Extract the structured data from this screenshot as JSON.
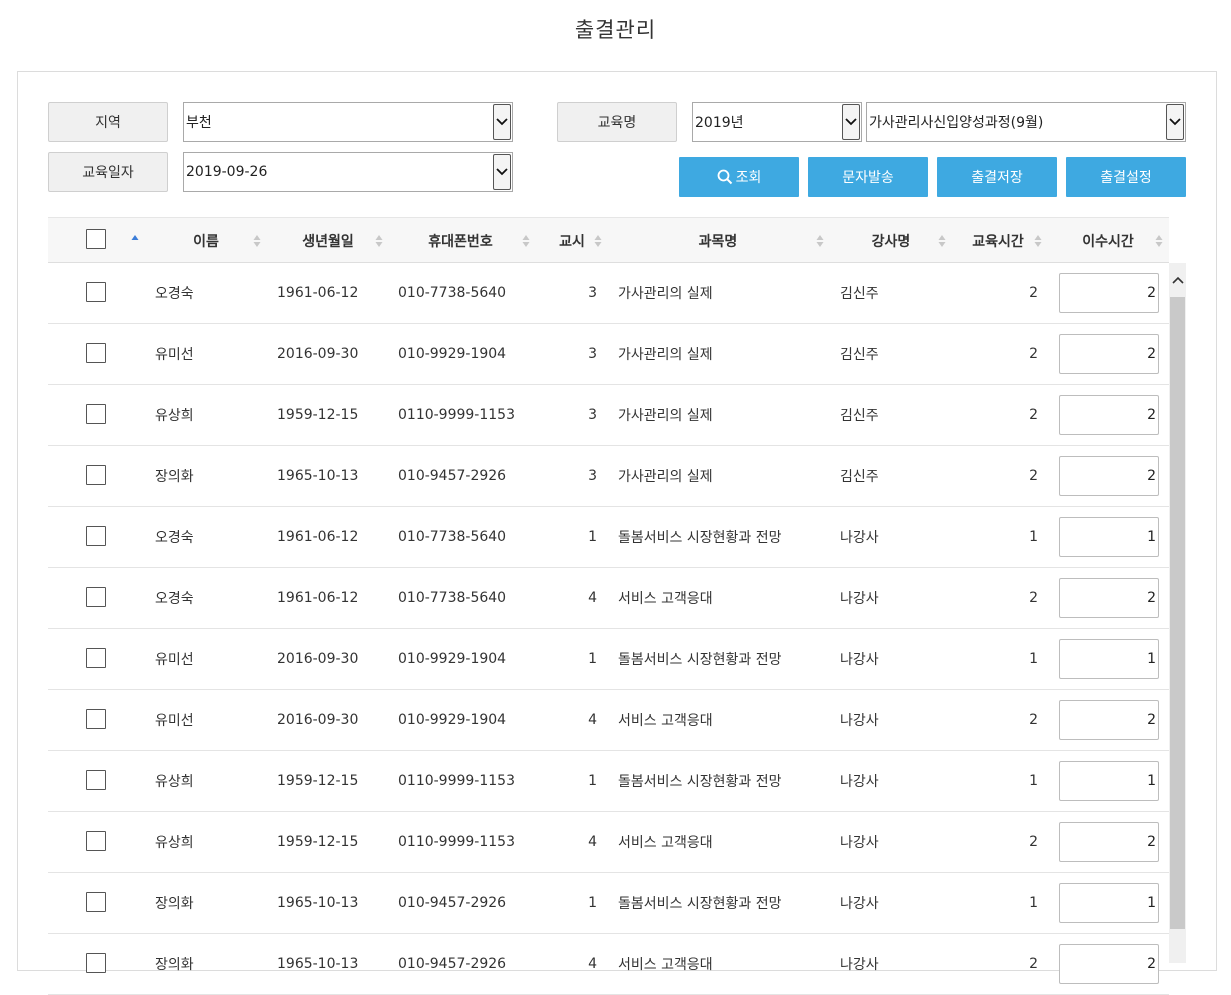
{
  "page": {
    "title": "출결관리"
  },
  "filters": {
    "region_label": "지역",
    "region_value": "부천",
    "course_label": "교육명",
    "year_value": "2019년",
    "course_value": "가사관리사신입양성과정(9월)",
    "date_label": "교육일자",
    "date_value": "2019-09-26"
  },
  "buttons": {
    "search": "조회",
    "sms": "문자발송",
    "save": "출결저장",
    "settings": "출결설정"
  },
  "colors": {
    "accent": "#3ea9e1",
    "sort_active": "#3b7dd8",
    "sort_inactive": "#c8c8c8"
  },
  "table": {
    "headers": [
      "이름",
      "생년월일",
      "휴대폰번호",
      "교시",
      "과목명",
      "강사명",
      "교육시간",
      "이수시간"
    ],
    "rows": [
      {
        "name": "오경숙",
        "birth": "1961-06-12",
        "phone": "010-7738-5640",
        "period": "3",
        "subject": "가사관리의 실제",
        "instructor": "김신주",
        "edu_hours": "2",
        "done_hours": "2"
      },
      {
        "name": "유미선",
        "birth": "2016-09-30",
        "phone": "010-9929-1904",
        "period": "3",
        "subject": "가사관리의 실제",
        "instructor": "김신주",
        "edu_hours": "2",
        "done_hours": "2"
      },
      {
        "name": "유상희",
        "birth": "1959-12-15",
        "phone": "0110-9999-1153",
        "period": "3",
        "subject": "가사관리의 실제",
        "instructor": "김신주",
        "edu_hours": "2",
        "done_hours": "2"
      },
      {
        "name": "장의화",
        "birth": "1965-10-13",
        "phone": "010-9457-2926",
        "period": "3",
        "subject": "가사관리의 실제",
        "instructor": "김신주",
        "edu_hours": "2",
        "done_hours": "2"
      },
      {
        "name": "오경숙",
        "birth": "1961-06-12",
        "phone": "010-7738-5640",
        "period": "1",
        "subject": "돌봄서비스 시장현황과 전망",
        "instructor": "나강사",
        "edu_hours": "1",
        "done_hours": "1"
      },
      {
        "name": "오경숙",
        "birth": "1961-06-12",
        "phone": "010-7738-5640",
        "period": "4",
        "subject": "서비스 고객응대",
        "instructor": "나강사",
        "edu_hours": "2",
        "done_hours": "2"
      },
      {
        "name": "유미선",
        "birth": "2016-09-30",
        "phone": "010-9929-1904",
        "period": "1",
        "subject": "돌봄서비스 시장현황과 전망",
        "instructor": "나강사",
        "edu_hours": "1",
        "done_hours": "1"
      },
      {
        "name": "유미선",
        "birth": "2016-09-30",
        "phone": "010-9929-1904",
        "period": "4",
        "subject": "서비스 고객응대",
        "instructor": "나강사",
        "edu_hours": "2",
        "done_hours": "2"
      },
      {
        "name": "유상희",
        "birth": "1959-12-15",
        "phone": "0110-9999-1153",
        "period": "1",
        "subject": "돌봄서비스 시장현황과 전망",
        "instructor": "나강사",
        "edu_hours": "1",
        "done_hours": "1"
      },
      {
        "name": "유상희",
        "birth": "1959-12-15",
        "phone": "0110-9999-1153",
        "period": "4",
        "subject": "서비스 고객응대",
        "instructor": "나강사",
        "edu_hours": "2",
        "done_hours": "2"
      },
      {
        "name": "장의화",
        "birth": "1965-10-13",
        "phone": "010-9457-2926",
        "period": "1",
        "subject": "돌봄서비스 시장현황과 전망",
        "instructor": "나강사",
        "edu_hours": "1",
        "done_hours": "1"
      },
      {
        "name": "장의화",
        "birth": "1965-10-13",
        "phone": "010-9457-2926",
        "period": "4",
        "subject": "서비스 고객응대",
        "instructor": "나강사",
        "edu_hours": "2",
        "done_hours": "2"
      }
    ]
  }
}
